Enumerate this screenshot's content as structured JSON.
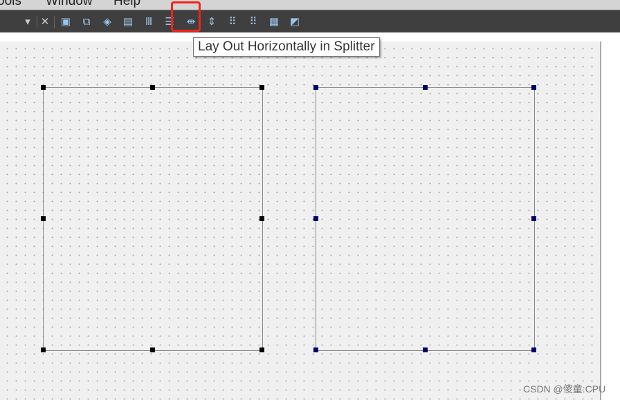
{
  "menubar": {
    "items": [
      "ools",
      "Window",
      "Help"
    ]
  },
  "toolbar": {
    "buttons": [
      {
        "name": "dropdown-arrow-icon",
        "glyph": "▾"
      },
      {
        "name": "close-icon",
        "glyph": "✕"
      },
      {
        "name": "edit-widgets-icon",
        "glyph": "▣"
      },
      {
        "name": "edit-signals-slots-icon",
        "glyph": "⧉"
      },
      {
        "name": "edit-buddies-icon",
        "glyph": "◈"
      },
      {
        "name": "edit-tab-order-icon",
        "glyph": "▤"
      },
      {
        "name": "lay-out-horizontally-icon",
        "glyph": "Ⅲ"
      },
      {
        "name": "lay-out-vertically-icon",
        "glyph": "☰"
      },
      {
        "name": "lay-out-horizontally-splitter-icon",
        "glyph": "⇹"
      },
      {
        "name": "lay-out-vertically-splitter-icon",
        "glyph": "⇕"
      },
      {
        "name": "lay-out-form-icon",
        "glyph": "⠿"
      },
      {
        "name": "lay-out-grid-icon",
        "glyph": "⠿"
      },
      {
        "name": "break-layout-icon",
        "glyph": "▦"
      },
      {
        "name": "adjust-size-icon",
        "glyph": "◩"
      }
    ]
  },
  "tooltip": "Lay Out Horizontally in Splitter",
  "watermark": "CSDN @傻童:CPU",
  "colors": {
    "toolbar": "#3e3f3e",
    "highlight": "#f2231b",
    "handle_selected": "#000000",
    "handle_secondary": "#000066"
  }
}
